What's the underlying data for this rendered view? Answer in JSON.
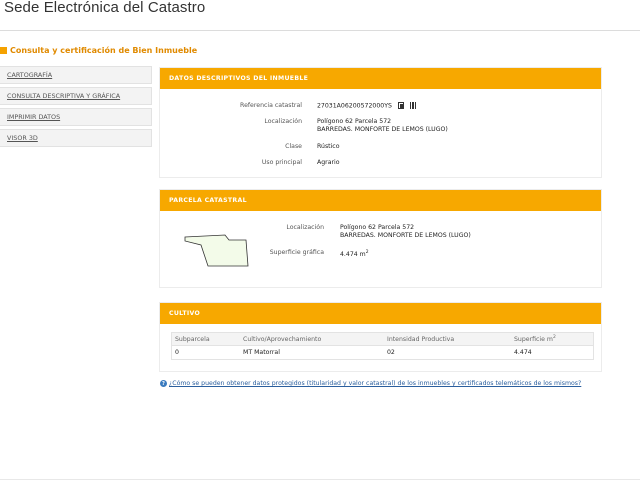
{
  "site": {
    "title": "Sede Electrónica del Catastro"
  },
  "page": {
    "heading": "Consulta y certificación de Bien Inmueble"
  },
  "sidebar": {
    "items": [
      {
        "label": "CARTOGRAFÍA"
      },
      {
        "label": "CONSULTA DESCRIPTIVA Y GRÁFICA"
      },
      {
        "label": "IMPRIMIR DATOS"
      },
      {
        "label": "VISOR 3D"
      }
    ]
  },
  "descriptivos": {
    "title": "DATOS DESCRIPTIVOS DEL INMUEBLE",
    "ref_label": "Referencia catastral",
    "ref_value": "27031A06200572000YS",
    "loc_label": "Localización",
    "loc_line1": "Polígono 62 Parcela 572",
    "loc_line2": "BARREDAS. MONFORTE DE LEMOS (LUGO)",
    "clase_label": "Clase",
    "clase_value": "Rústico",
    "uso_label": "Uso principal",
    "uso_value": "Agrario"
  },
  "parcela": {
    "title": "PARCELA CATASTRAL",
    "loc_label": "Localización",
    "loc_line1": "Polígono 62 Parcela 572",
    "loc_line2": "BARREDAS. MONFORTE DE LEMOS (LUGO)",
    "sup_label": "Superficie gráfica",
    "sup_value": "4.474 m",
    "sup_exp": "2",
    "shape_fill": "#f3fbe9",
    "shape_stroke": "#333333"
  },
  "cultivo": {
    "title": "CULTIVO",
    "headers": [
      "Subparcela",
      "Cultivo/Aprovechamiento",
      "Intensidad Productiva",
      "Superficie m"
    ],
    "header_exp": "2",
    "rows": [
      [
        "0",
        "MT Matorral",
        "02",
        "4.474"
      ]
    ]
  },
  "footer": {
    "info_icon": "question-circle-icon",
    "link": "¿Cómo se pueden obtener datos protegidos (titularidad y valor catastral) de los inmuebles y certificados telemáticos de los mismos?"
  },
  "colors": {
    "accent": "#f7a800",
    "heading": "#e08a00",
    "link": "#2b5f9e"
  }
}
